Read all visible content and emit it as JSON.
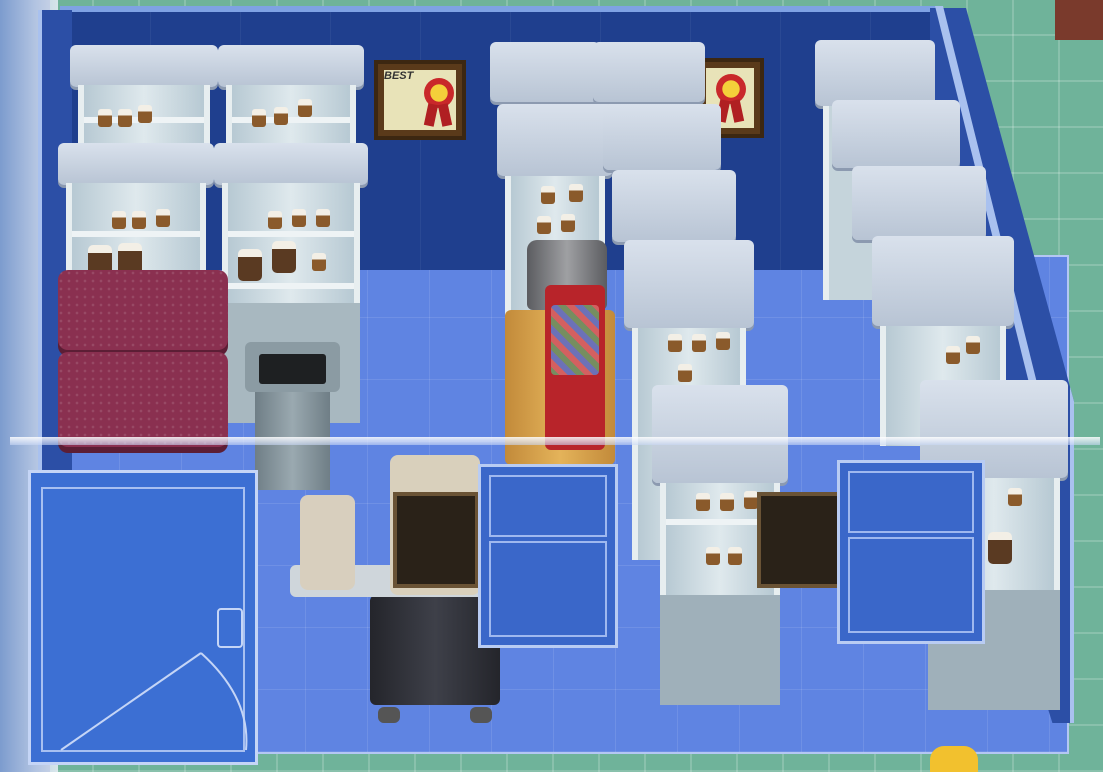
{
  "scene": {
    "type": "pharmacy-room",
    "game_view": "isometric-top-down"
  },
  "wall_frames": [
    {
      "label": "BEST",
      "icon": "award-rosette-icon"
    },
    {
      "label": "",
      "icon": "award-rosette-icon"
    }
  ],
  "colors": {
    "floor": "#5f84e2",
    "wall": "#1f3f8e",
    "cabinet": "#d9e1ec",
    "bed": "#8a3050",
    "outside_tiles": "#6fb39a"
  }
}
